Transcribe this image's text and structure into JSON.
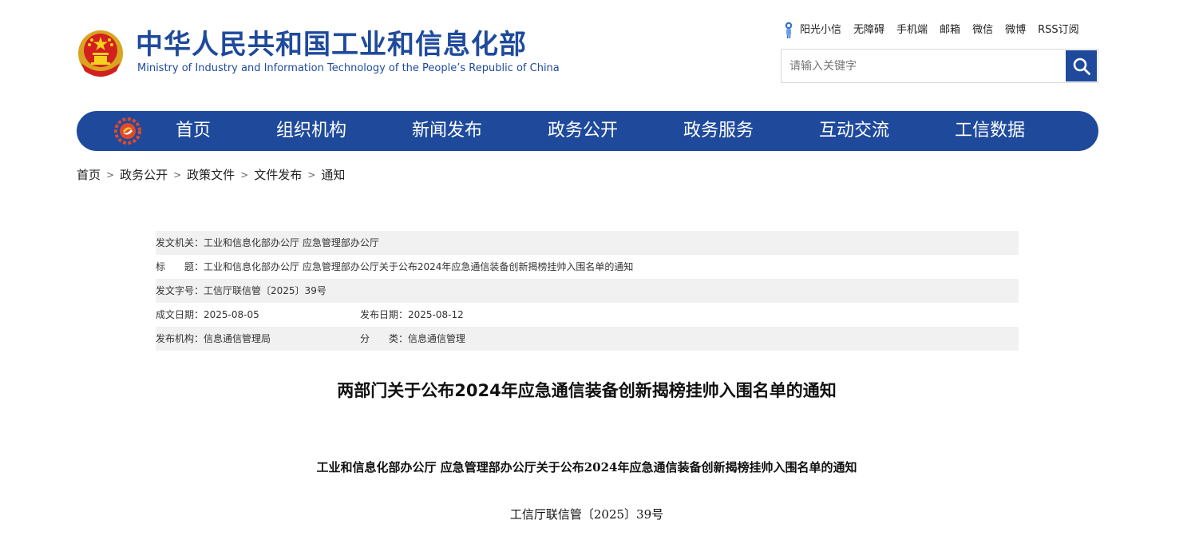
{
  "header": {
    "site_title": "中华人民共和国工业和信息化部",
    "site_subtitle": "Ministry of Industry and Information Technology of the People’s Republic of China",
    "top_links": [
      "阳光小信",
      "无障碍",
      "手机端",
      "邮箱",
      "微信",
      "微博",
      "RSS订阅"
    ],
    "search_placeholder": "请输入关键字",
    "brand_color": "#1f4a9c"
  },
  "nav": {
    "items": [
      "首页",
      "组织机构",
      "新闻发布",
      "政务公开",
      "政务服务",
      "互动交流",
      "工信数据"
    ]
  },
  "breadcrumb": [
    "首页",
    "政务公开",
    "政策文件",
    "文件发布",
    "通知"
  ],
  "meta": {
    "issuer_label": "发文机关：",
    "issuer": "工业和信息化部办公厅 应急管理部办公厅",
    "title_label": "标　　题：",
    "title": "工业和信息化部办公厅 应急管理部办公厅关于公布2024年应急通信装备创新揭榜挂帅入围名单的通知",
    "docno_label": "发文字号：",
    "docno": "工信厅联信管〔2025〕39号",
    "created_label": "成文日期：",
    "created": "2025-08-05",
    "published_label": "发布日期：",
    "published": "2025-08-12",
    "org_label": "发布机构：",
    "org": "信息通信管理局",
    "category_label": "分　　类：",
    "category": "信息通信管理"
  },
  "article": {
    "title": "两部门关于公布2024年应急通信装备创新揭榜挂帅入围名单的通知",
    "subtitle": "工业和信息化部办公厅  应急管理部办公厅关于公布2024年应急通信装备创新揭榜挂帅入围名单的通知",
    "docno": "工信厅联信管〔2025〕39号"
  }
}
